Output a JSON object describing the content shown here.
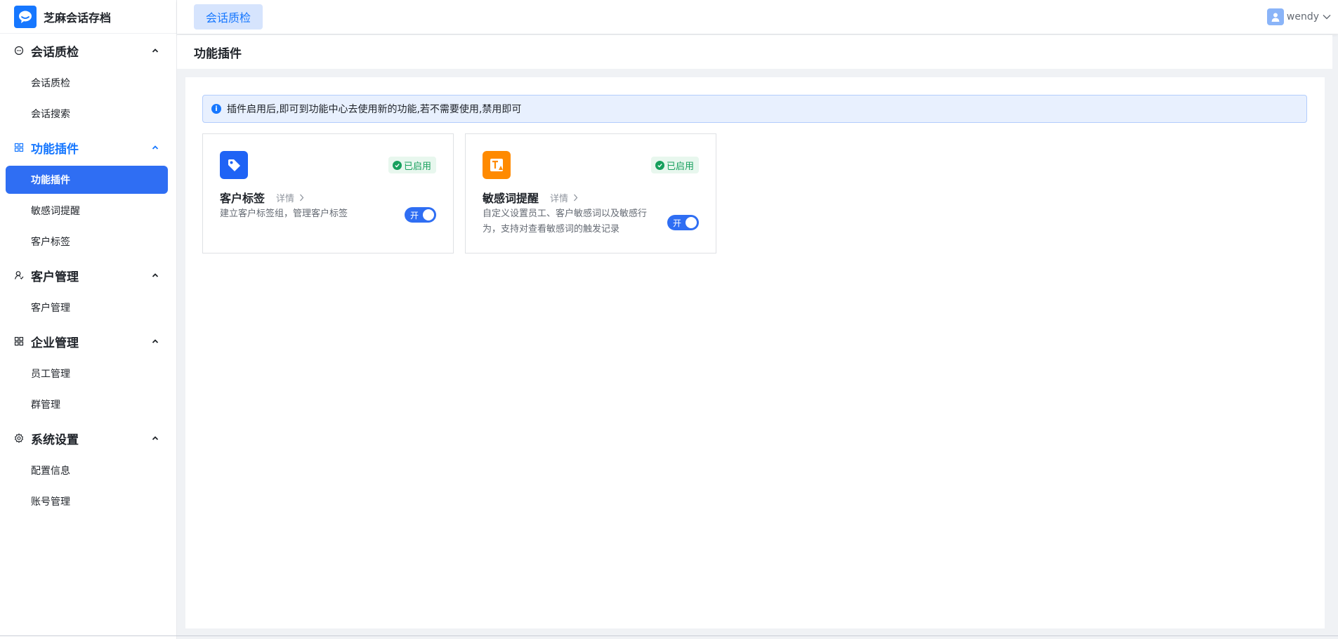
{
  "app": {
    "title": "芝麻会话存档"
  },
  "topbar": {
    "active_tab": "会话质检",
    "user_name": "wendy"
  },
  "sidebar": {
    "groups": [
      {
        "title": "会话质检",
        "icon": "chat-bubble-icon",
        "items": [
          "会话质检",
          "会话搜索"
        ]
      },
      {
        "title": "功能插件",
        "icon": "grid-icon",
        "items": [
          "功能插件",
          "敏感词提醒",
          "客户标签"
        ]
      },
      {
        "title": "客户管理",
        "icon": "customer-icon",
        "items": [
          "客户管理"
        ]
      },
      {
        "title": "企业管理",
        "icon": "grid-icon",
        "items": [
          "员工管理",
          "群管理"
        ]
      },
      {
        "title": "系统设置",
        "icon": "gear-icon",
        "items": [
          "配置信息",
          "账号管理"
        ]
      }
    ],
    "active_group": "功能插件",
    "active_item": "功能插件"
  },
  "page": {
    "title": "功能插件",
    "notice": "插件启用后,即可到功能中心去使用新的功能,若不需要使用,禁用即可"
  },
  "plugins": [
    {
      "title": "客户标签",
      "detail_label": "详情",
      "status": "已启用",
      "description_lines": [
        "建立客户标签组，管理客户标签"
      ],
      "toggle_label": "开",
      "enabled": true,
      "icon": "tag-icon",
      "icon_color": "#1f63f5"
    },
    {
      "title": "敏感词提醒",
      "detail_label": "详情",
      "status": "已启用",
      "description_lines": [
        "自定义设置员工、客户敏感词以及敏感行",
        "为，支持对查看敏感词的触发记录"
      ],
      "toggle_label": "开",
      "enabled": true,
      "icon": "text-alert-icon",
      "icon_color": "#ff8a00"
    }
  ],
  "colors": {
    "primary": "#1677ff",
    "active_menu_bg": "#2f6ef3",
    "status_green": "#17a05d"
  }
}
